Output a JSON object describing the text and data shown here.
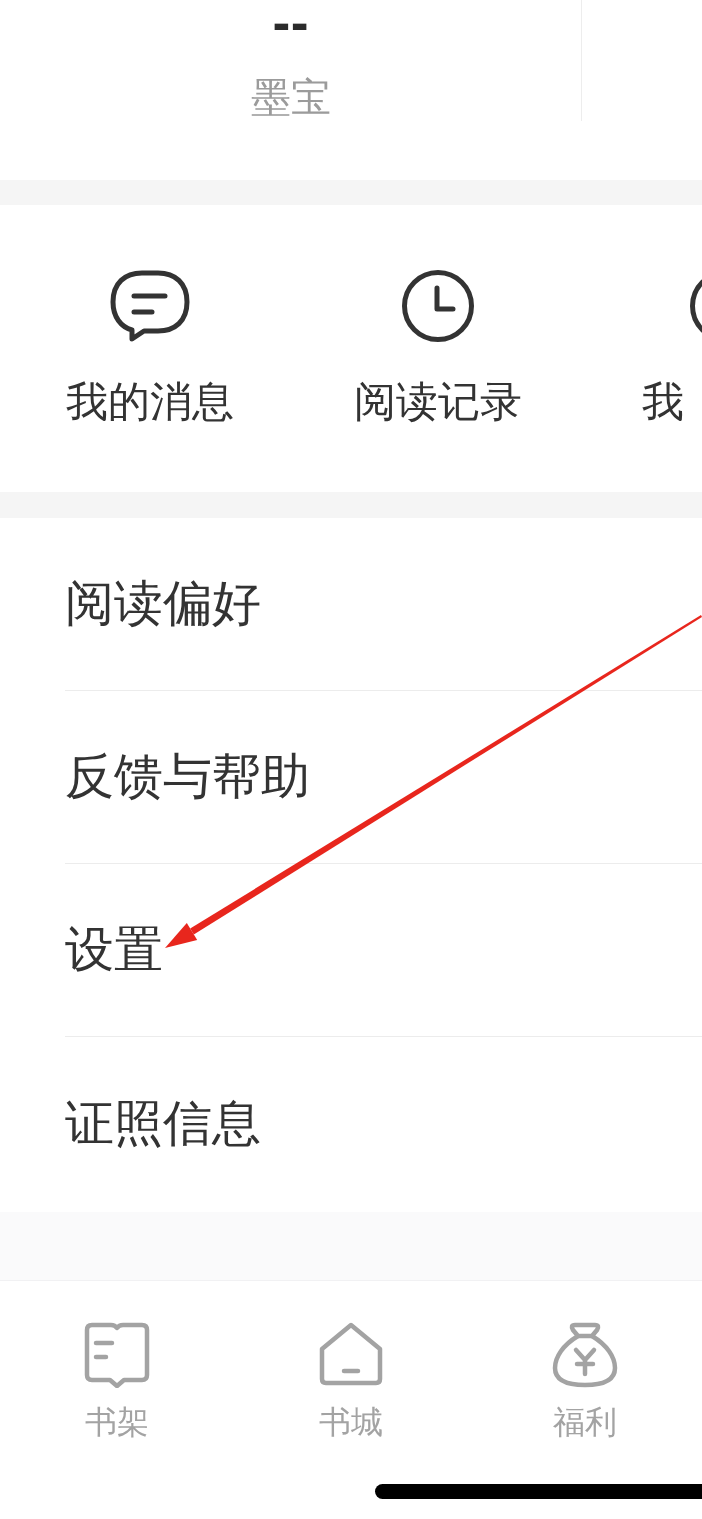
{
  "profile_stats": [
    {
      "value": "--",
      "label": "墨宝"
    }
  ],
  "shortcuts": [
    {
      "label": "我的消息"
    },
    {
      "label": "阅读记录"
    },
    {
      "label": "我"
    }
  ],
  "menu": [
    {
      "label": "阅读偏好"
    },
    {
      "label": "反馈与帮助"
    },
    {
      "label": "设置"
    },
    {
      "label": "证照信息"
    }
  ],
  "tab_bar": [
    {
      "label": "书架",
      "selected": false
    },
    {
      "label": "书城",
      "selected": false
    },
    {
      "label": "福利",
      "selected": false
    }
  ],
  "annotation": {
    "kind": "arrow"
  }
}
